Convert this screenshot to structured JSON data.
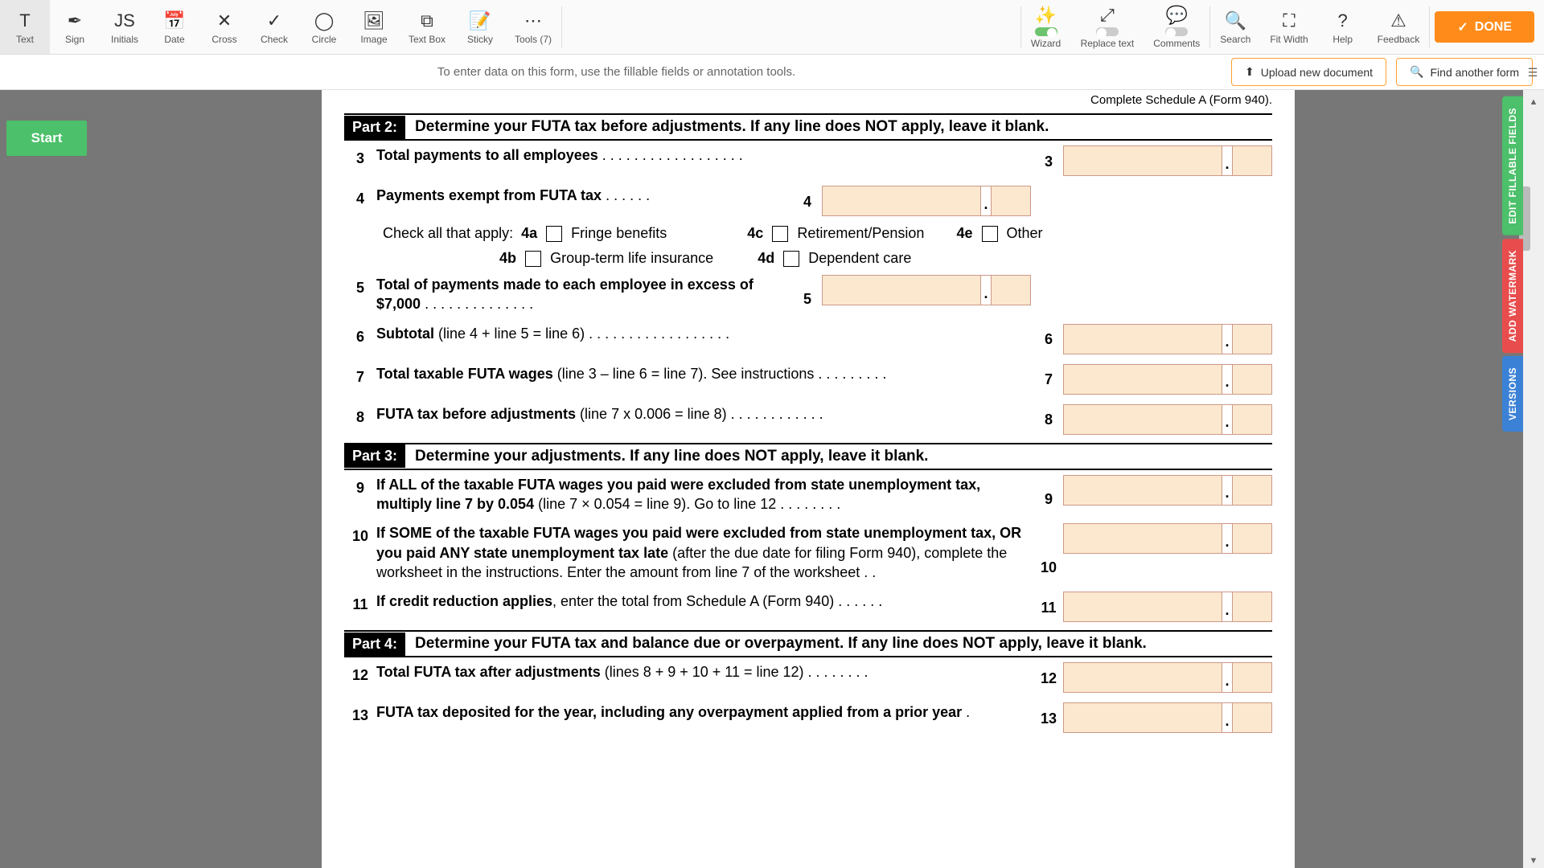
{
  "toolbar": {
    "items": [
      {
        "icon": "T",
        "label": "Text"
      },
      {
        "icon": "✒",
        "label": "Sign"
      },
      {
        "icon": "JS",
        "label": "Initials"
      },
      {
        "icon": "📅",
        "label": "Date"
      },
      {
        "icon": "✕",
        "label": "Cross"
      },
      {
        "icon": "✓",
        "label": "Check"
      },
      {
        "icon": "◯",
        "label": "Circle"
      },
      {
        "icon": "🖼",
        "label": "Image"
      },
      {
        "icon": "⧉",
        "label": "Text Box"
      },
      {
        "icon": "📝",
        "label": "Sticky"
      },
      {
        "icon": "⋯",
        "label": "Tools (7)"
      }
    ],
    "mid": [
      {
        "icon": "✨",
        "label": "Wizard",
        "toggle": "on"
      },
      {
        "icon": "⤢",
        "label": "Replace text",
        "toggle": "off"
      },
      {
        "icon": "💬",
        "label": "Comments",
        "toggle": "off"
      }
    ],
    "right": [
      {
        "icon": "🔍",
        "label": "Search"
      },
      {
        "icon": "⛶",
        "label": "Fit Width"
      },
      {
        "icon": "?",
        "label": "Help"
      },
      {
        "icon": "⚠",
        "label": "Feedback"
      }
    ],
    "done": "DONE"
  },
  "subbar": {
    "hint": "To enter data on this form, use the fillable fields or annotation tools.",
    "upload": "Upload new document",
    "find": "Find another form"
  },
  "start": "Start",
  "side_tabs": {
    "edit": "EDIT FILLABLE FIELDS",
    "watermark": "ADD WATERMARK",
    "versions": "VERSIONS"
  },
  "form": {
    "cutline": "Complete Schedule A (Form 940).",
    "parts": [
      {
        "id": "Part 2:",
        "title": "Determine your FUTA tax before adjustments. If any line does NOT apply, leave it blank."
      },
      {
        "id": "Part 3:",
        "title": "Determine your adjustments. If any line does NOT apply, leave it blank."
      },
      {
        "id": "Part 4:",
        "title": "Determine your FUTA tax and balance due or overpayment. If any line does NOT apply, leave it blank."
      }
    ],
    "lines": {
      "l3": {
        "n": "3",
        "b": "Total payments to all employees",
        "r": "3"
      },
      "l4": {
        "n": "4",
        "b": "Payments exempt from FUTA tax",
        "m": "4"
      },
      "chk_prefix": "Check all that apply:",
      "c4a": {
        "id": "4a",
        "t": "Fringe benefits"
      },
      "c4b": {
        "id": "4b",
        "t": "Group-term life insurance"
      },
      "c4c": {
        "id": "4c",
        "t": "Retirement/Pension"
      },
      "c4d": {
        "id": "4d",
        "t": "Dependent care"
      },
      "c4e": {
        "id": "4e",
        "t": "Other"
      },
      "l5": {
        "n": "5",
        "b": "Total of payments made to each employee in excess of $7,000",
        "m": "5"
      },
      "l6": {
        "n": "6",
        "b": "Subtotal",
        "p": " (line 4 + line 5 = line 6)",
        "r": "6"
      },
      "l7": {
        "n": "7",
        "b": "Total taxable FUTA wages",
        "p": " (line 3 – line 6 = line 7). See instructions .",
        "r": "7"
      },
      "l8": {
        "n": "8",
        "b": "FUTA tax before adjustments",
        "p": " (line 7 x 0.006 = line 8)",
        "r": "8"
      },
      "l9": {
        "n": "9",
        "b": "If ALL of the taxable FUTA wages you paid were excluded from state unemployment tax, multiply line 7 by 0.054",
        "p": "  (line 7 × 0.054 = line 9). Go to line 12",
        "r": "9"
      },
      "l10": {
        "n": "10",
        "b": "If SOME of the taxable FUTA wages you paid were excluded from state unemployment tax, OR you paid ANY state unemployment tax late",
        "p": " (after the due date for filing Form 940), complete the worksheet in the instructions. Enter the amount from line 7 of the worksheet .",
        "r": "10"
      },
      "l11": {
        "n": "11",
        "b": "If credit reduction applies",
        "p": ", enter the total from Schedule A (Form 940)",
        "r": "11"
      },
      "l12": {
        "n": "12",
        "b": "Total FUTA tax after adjustments",
        "p": " (lines 8 + 9 + 10 + 11 = line 12)",
        "r": "12"
      },
      "l13": {
        "n": "13",
        "b": "FUTA tax deposited for the year, including any overpayment applied from a prior year",
        "r": "13"
      }
    }
  }
}
